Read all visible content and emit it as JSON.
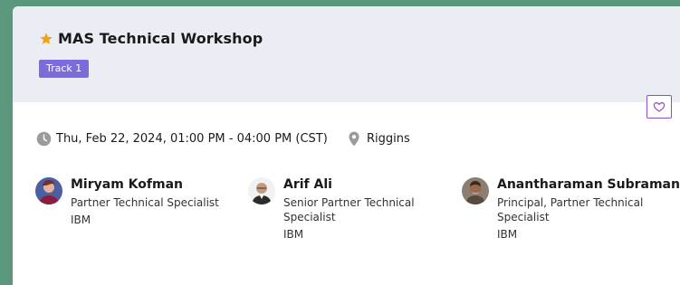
{
  "session": {
    "title": "MAS Technical Workshop",
    "track": "Track 1",
    "datetime": "Thu, Feb 22, 2024, 01:00 PM - 04:00 PM (CST)",
    "location": "Riggins"
  },
  "speakers": [
    {
      "name": "Miryam Kofman",
      "role": "Partner Technical Specialist",
      "org": "IBM"
    },
    {
      "name": "Arif Ali",
      "role": "Senior Partner Technical Specialist",
      "org": "IBM"
    },
    {
      "name": "Anantharaman Subramani...",
      "role": "Principal, Partner Technical Specialist",
      "org": "IBM"
    }
  ],
  "colors": {
    "background": "#5b977d",
    "header_bg": "#eaedf3",
    "track_badge": "#7b6cdb",
    "favorite_border": "#8e4fc2",
    "star": "#f4a11a"
  },
  "icons": {
    "star": "star-icon",
    "favorite": "heart-icon",
    "time": "clock-icon",
    "location": "map-pin-icon"
  }
}
